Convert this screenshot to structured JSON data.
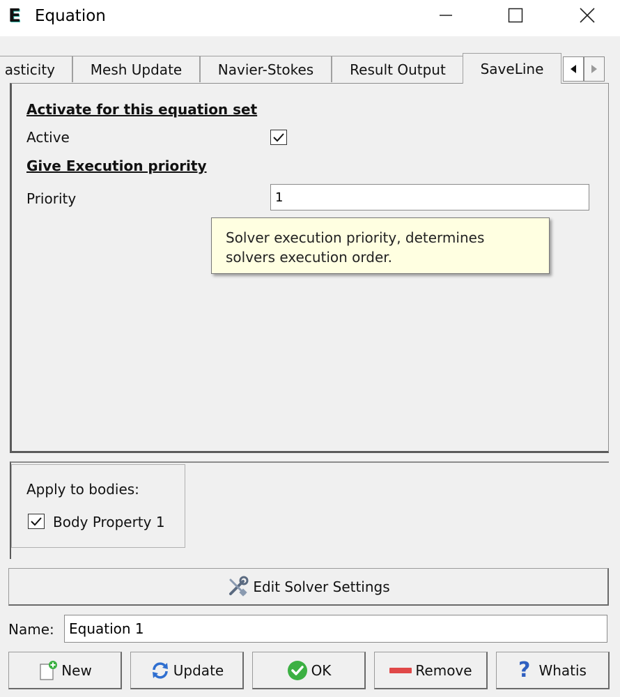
{
  "window": {
    "title": "Equation",
    "app_icon_letter": "E"
  },
  "tabs": [
    {
      "label": "asticity",
      "active": false
    },
    {
      "label": "Mesh Update",
      "active": false
    },
    {
      "label": "Navier-Stokes",
      "active": false
    },
    {
      "label": "Result Output",
      "active": false
    },
    {
      "label": "SaveLine",
      "active": true
    }
  ],
  "panel": {
    "active_heading": "Activate for this equation set",
    "active_label": "Active",
    "active_checked": true,
    "priority_heading": "Give Execution priority",
    "priority_label": "Priority",
    "priority_value": "1",
    "tooltip": "Solver execution priority, determines solvers execution order."
  },
  "bodies": {
    "label": "Apply to bodies:",
    "items": [
      {
        "label": "Body Property 1",
        "checked": true
      }
    ]
  },
  "edit_solver_label": "Edit Solver Settings",
  "name_field": {
    "label": "Name:",
    "value": "Equation 1"
  },
  "buttons": {
    "new": "New",
    "update": "Update",
    "ok": "OK",
    "remove": "Remove",
    "whatis": "Whatis"
  },
  "colors": {
    "tooltip_bg": "#ffffe1",
    "ok_green": "#3cb043",
    "remove_red": "#e04848",
    "update_blue": "#2f6fd0"
  }
}
